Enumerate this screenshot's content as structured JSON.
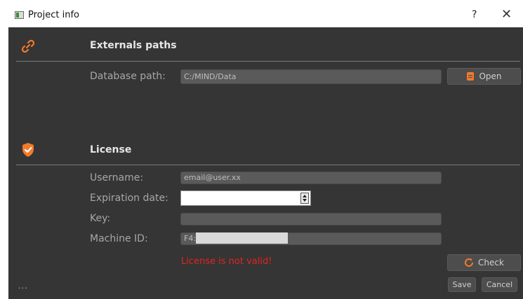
{
  "window": {
    "title": "Project info",
    "help": "?",
    "close": "✕"
  },
  "externals": {
    "title": "Externals paths",
    "database_label": "Database path:",
    "database_value": "C:/MIND/Data",
    "open_label": "Open"
  },
  "license": {
    "title": "License",
    "username_label": "Username:",
    "username_value": "email@user.xx",
    "expiration_label": "Expiration date:",
    "expiration_value": "",
    "key_label": "Key:",
    "key_value": "",
    "machine_label": "Machine ID:",
    "machine_value": "F4:",
    "error": "License is not valid!",
    "check_label": "Check"
  },
  "footer": {
    "more": "...",
    "save_label": "Save",
    "cancel_label": "Cancel"
  },
  "colors": {
    "accent": "#f47a2a",
    "error": "#e2241f",
    "background": "#353535"
  }
}
